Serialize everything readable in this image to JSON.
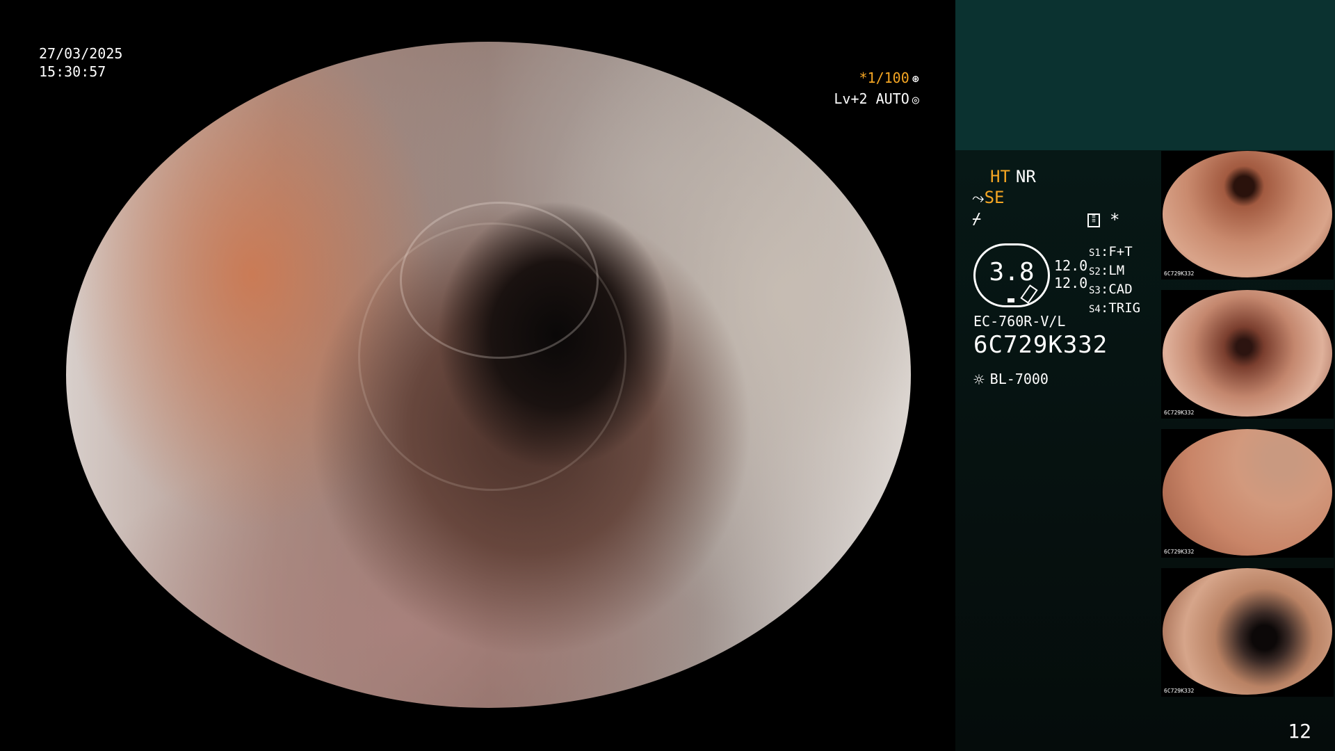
{
  "overlay": {
    "date": "27/03/2025",
    "time": "15:30:57",
    "shutter": "*1/100",
    "shutter_icon": "aperture-icon",
    "level": "Lv+2 AUTO",
    "level_icon": "iris-icon"
  },
  "panel": {
    "mode_ht": "HT",
    "mode_nr": "NR",
    "mode_se": "SE",
    "star": "*",
    "gauge_value": "3.8",
    "values": [
      "12.0",
      "12.0"
    ],
    "slots": [
      {
        "key": "S1",
        "value": "F+T"
      },
      {
        "key": "S2",
        "value": "LM"
      },
      {
        "key": "S3",
        "value": "CAD"
      },
      {
        "key": "S4",
        "value": "TRIG"
      }
    ],
    "model": "EC-760R-V/L",
    "serial": "6C729K332",
    "light_source": "BL-7000"
  },
  "thumbnails": [
    {
      "caption": "6C729K332"
    },
    {
      "caption": "6C729K332"
    },
    {
      "caption": "6C729K332"
    },
    {
      "caption": "6C729K332"
    }
  ],
  "page_number": "12",
  "colors": {
    "accent_orange": "#f5a623",
    "panel_teal": "#0b3230",
    "panel_dark": "#050c0b"
  }
}
